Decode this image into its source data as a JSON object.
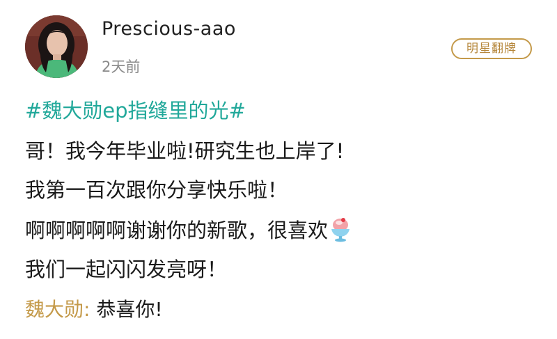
{
  "post": {
    "username": "Prescious-aao",
    "timestamp": "2天前",
    "badge_label": "明星翻牌",
    "hashtag": "#魏大勋ep指缝里的光#",
    "lines": [
      "哥！我今年毕业啦!研究生也上岸了!",
      "我第一百次跟你分享快乐啦！",
      "啊啊啊啊啊谢谢你的新歌，很喜欢",
      "我们一起闪闪发亮呀！"
    ],
    "emoji": "shaved-ice-icon"
  },
  "reply": {
    "author": "魏大勋:",
    "text": " 恭喜你!"
  },
  "colors": {
    "hashtag": "#21a89a",
    "badge": "#c49a4a",
    "reply_author": "#c49a4a",
    "timestamp": "#8a8a8a"
  }
}
